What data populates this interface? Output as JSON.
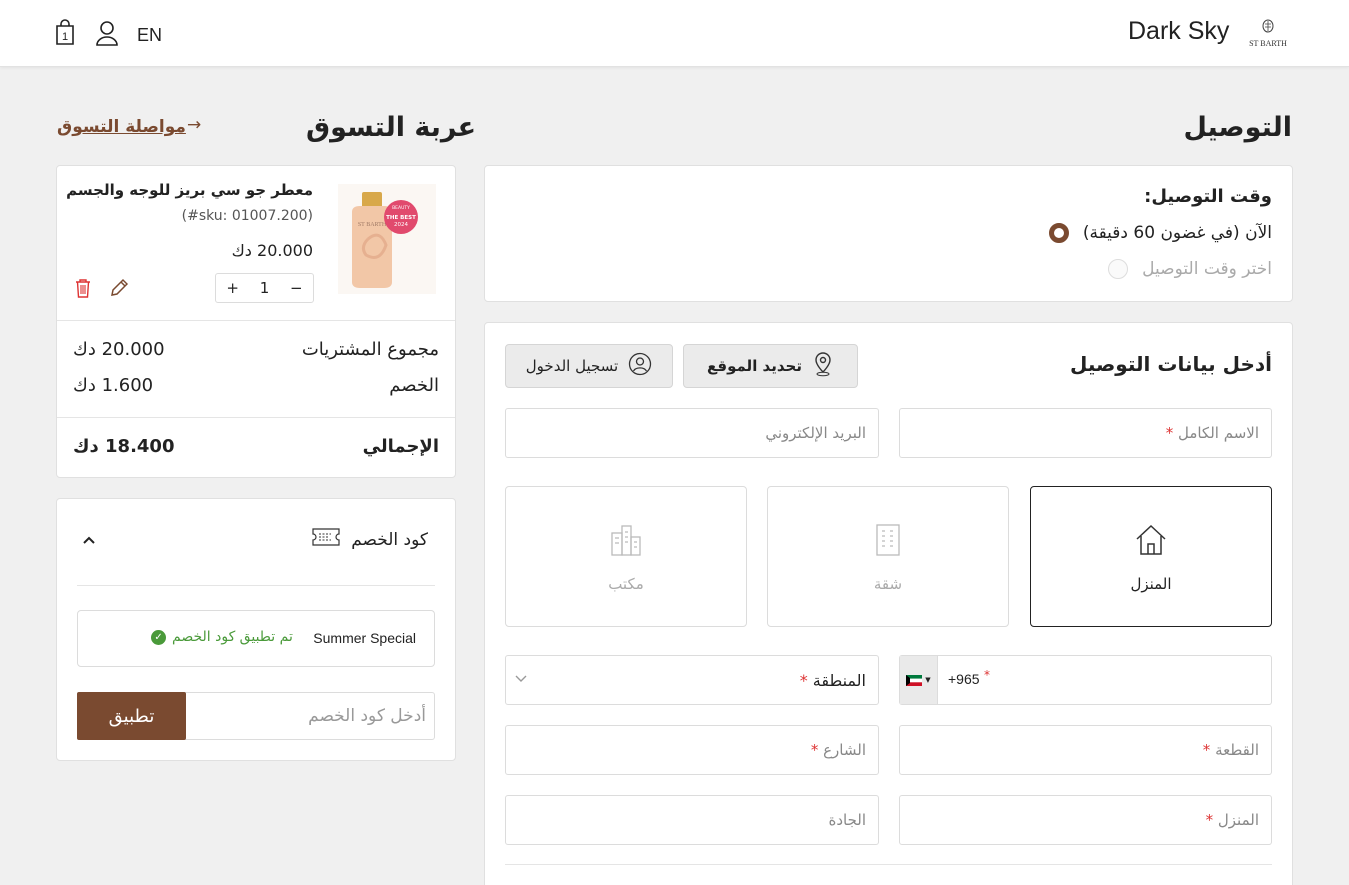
{
  "header": {
    "store_name": "Dark Sky",
    "lang": "EN",
    "cart_count": "1",
    "logo_text": "ST BARTH"
  },
  "page": {
    "title": "التوصيل",
    "cart_title": "عربة التسوق",
    "continue_shopping": "مواصلة التسوق"
  },
  "delivery_time": {
    "title": "وقت التوصيل:",
    "options": [
      {
        "label": "الآن (في غضون 60 دقيقة)",
        "selected": true
      },
      {
        "label": "اختر وقت التوصيل",
        "selected": false
      }
    ]
  },
  "delivery_form": {
    "title": "أدخل بيانات التوصيل",
    "locate_label": "تحديد الموقع",
    "login_label": "تسجيل الدخول",
    "full_name_ph": "الاسم الكامل",
    "email_ph": "البريد الإلكتروني",
    "types": [
      {
        "label": "المنزل",
        "icon": "house-icon",
        "active": true
      },
      {
        "label": "شقة",
        "icon": "apartment-icon",
        "active": false
      },
      {
        "label": "مكتب",
        "icon": "office-icon",
        "active": false
      }
    ],
    "phone_code": "+965",
    "region_ph": "المنطقة",
    "block_ph": "القطعة",
    "street_ph": "الشارع",
    "house_ph": "المنزل",
    "avenue_ph": "الجادة"
  },
  "cart": {
    "item": {
      "name": "معطر جو سي بريز للوجه والجسم",
      "sku": "(#sku: 01007.200)",
      "price": "20.000 دك",
      "qty": "1",
      "badge_top": "BEAUTY",
      "badge_main": "THE BEST",
      "badge_year": "2024"
    },
    "subtotal_label": "مجموع المشتريات",
    "subtotal_value": "20.000 دك",
    "discount_label": "الخصم",
    "discount_value": "1.600 دك",
    "total_label": "الإجمالي",
    "total_value": "18.400 دك"
  },
  "coupon": {
    "title": "كود الخصم",
    "applied_code": "Summer Special",
    "applied_msg": "تم تطبيق كود الخصم",
    "input_ph": "أدخل كود الخصم",
    "apply_label": "تطبيق"
  },
  "colors": {
    "accent": "#7a4a30",
    "success": "#4a9a3a",
    "required": "#d33333"
  }
}
